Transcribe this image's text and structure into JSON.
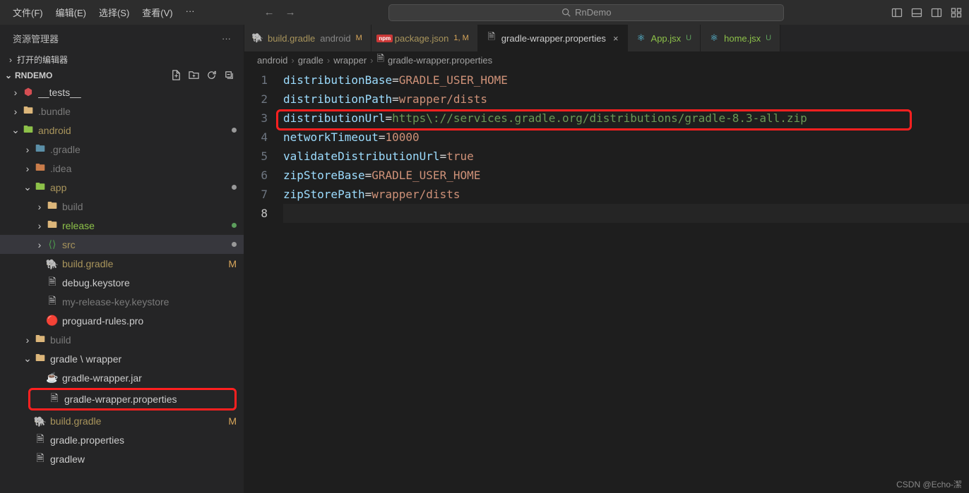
{
  "menu": {
    "file": "文件(F)",
    "edit": "编辑(E)",
    "select": "选择(S)",
    "view": "查看(V)",
    "more": "···"
  },
  "search": {
    "text": "RnDemo"
  },
  "sidebar": {
    "title": "资源管理器",
    "openEditors": "打开的编辑器",
    "project": "RNDEMO",
    "tree": {
      "tests": "__tests__",
      "bundle": ".bundle",
      "android": "android",
      "gradleHidden": ".gradle",
      "idea": ".idea",
      "app": "app",
      "build": "build",
      "release": "release",
      "src": "src",
      "buildGradle": "build.gradle",
      "buildGradleM": "M",
      "debugKeystore": "debug.keystore",
      "myReleaseKey": "my-release-key.keystore",
      "proguard": "proguard-rules.pro",
      "build2": "build",
      "gradleWrapper": "gradle \\ wrapper",
      "gradleWrapperJar": "gradle-wrapper.jar",
      "gradleWrapperProps": "gradle-wrapper.properties",
      "buildGradle2": "build.gradle",
      "buildGradle2M": "M",
      "gradleProps": "gradle.properties",
      "gradlew": "gradlew"
    }
  },
  "tabs": [
    {
      "icon": "gradle",
      "name": "build.gradle",
      "suffix": "android",
      "status": "M",
      "statusClass": "mod-st"
    },
    {
      "icon": "npm",
      "name": "package.json",
      "status": "1, M",
      "statusClass": "mod-st"
    },
    {
      "icon": "file",
      "name": "gradle-wrapper.properties",
      "close": "×",
      "active": true
    },
    {
      "icon": "react",
      "name": "App.jsx",
      "status": "U",
      "statusClass": "unt-st"
    },
    {
      "icon": "react",
      "name": "home.jsx",
      "status": "U",
      "statusClass": "unt-st"
    }
  ],
  "breadcrumb": {
    "p1": "android",
    "p2": "gradle",
    "p3": "wrapper",
    "p4": "gradle-wrapper.properties"
  },
  "code": {
    "l1k": "distributionBase",
    "l1v": "GRADLE_USER_HOME",
    "l2k": "distributionPath",
    "l2v": "wrapper/dists",
    "l3k": "distributionUrl",
    "l3v": "https\\://services.gradle.org/distributions/gradle-8.3-all.zip",
    "l4k": "networkTimeout",
    "l4v": "10000",
    "l5k": "validateDistributionUrl",
    "l5v": "true",
    "l6k": "zipStoreBase",
    "l6v": "GRADLE_USER_HOME",
    "l7k": "zipStorePath",
    "l7v": "wrapper/dists"
  },
  "lineNumbers": [
    "1",
    "2",
    "3",
    "4",
    "5",
    "6",
    "7",
    "8"
  ],
  "watermark": "CSDN @Echo-潔"
}
